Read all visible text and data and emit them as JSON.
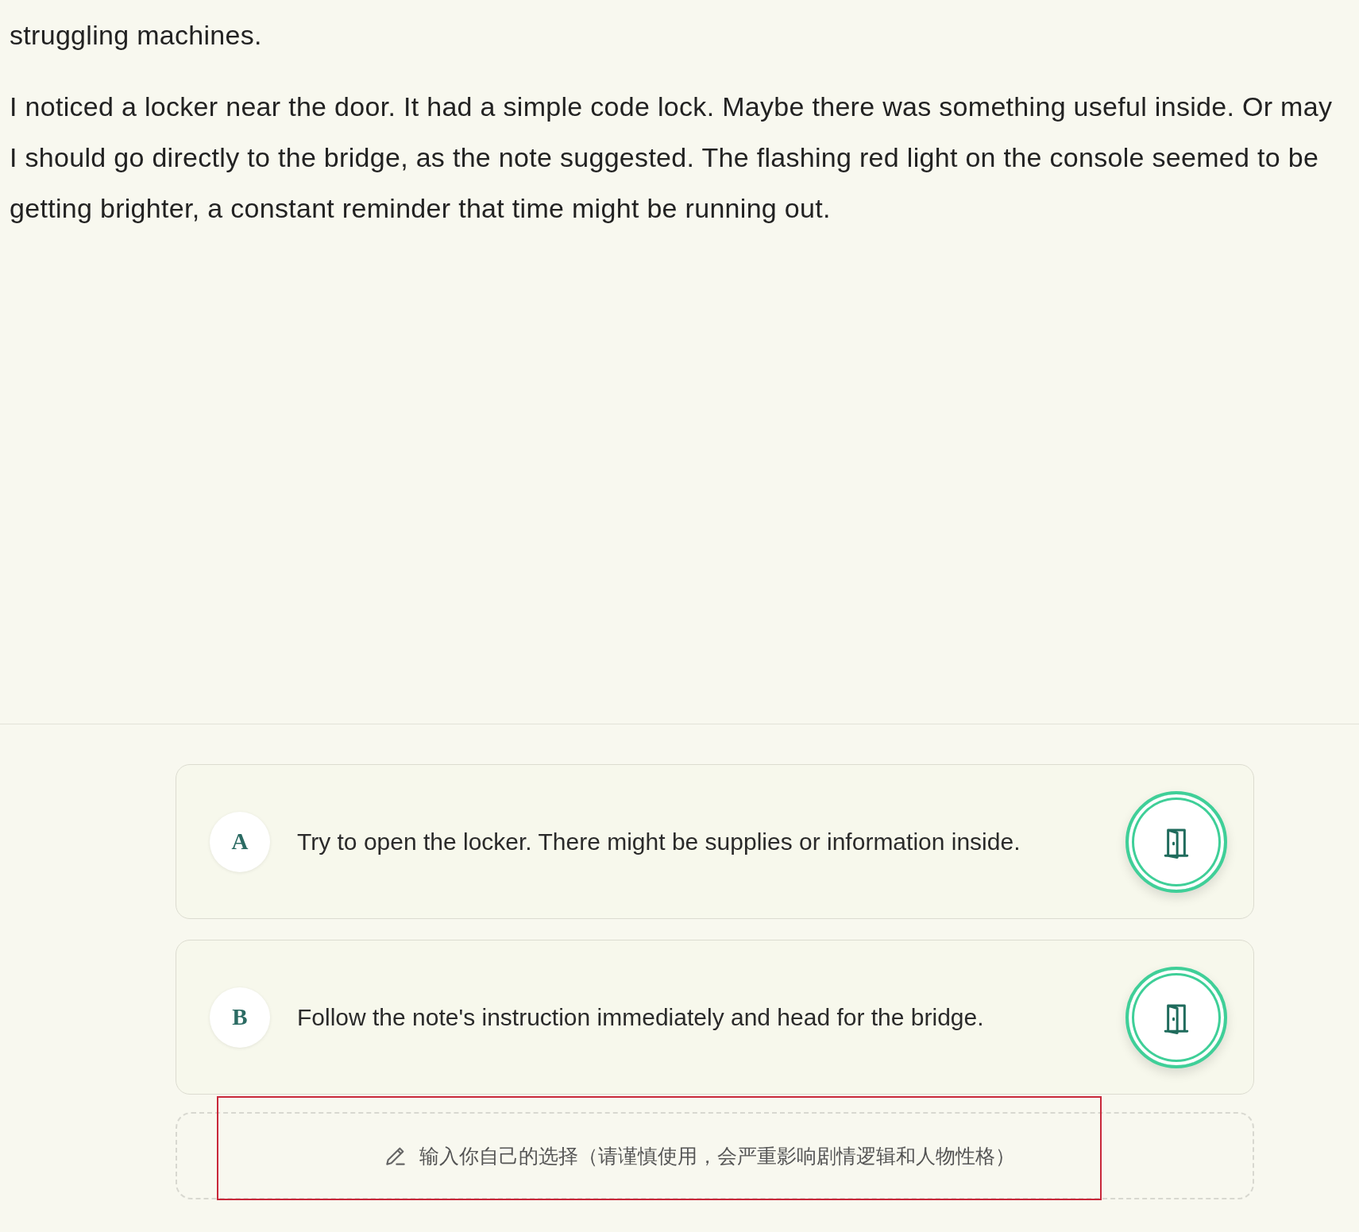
{
  "story": {
    "paragraphs": [
      {
        "lines": [
          "struggling machines."
        ]
      },
      {
        "lines": [
          "I noticed a locker near the door. It had a simple code lock. Maybe there was something useful inside. Or may",
          "I should go directly to the bridge, as the note suggested. The flashing red light on the console seemed to be",
          "getting brighter, a constant reminder that time might be running out."
        ]
      }
    ]
  },
  "choices": [
    {
      "letter": "A",
      "text": "Try to open the locker. There might be supplies or information inside."
    },
    {
      "letter": "B",
      "text": "Follow the note's instruction immediately and head for the bridge."
    }
  ],
  "custom_choice": {
    "placeholder": "输入你自己的选择（请谨慎使用，会严重影响剧情逻辑和人物性格）"
  }
}
